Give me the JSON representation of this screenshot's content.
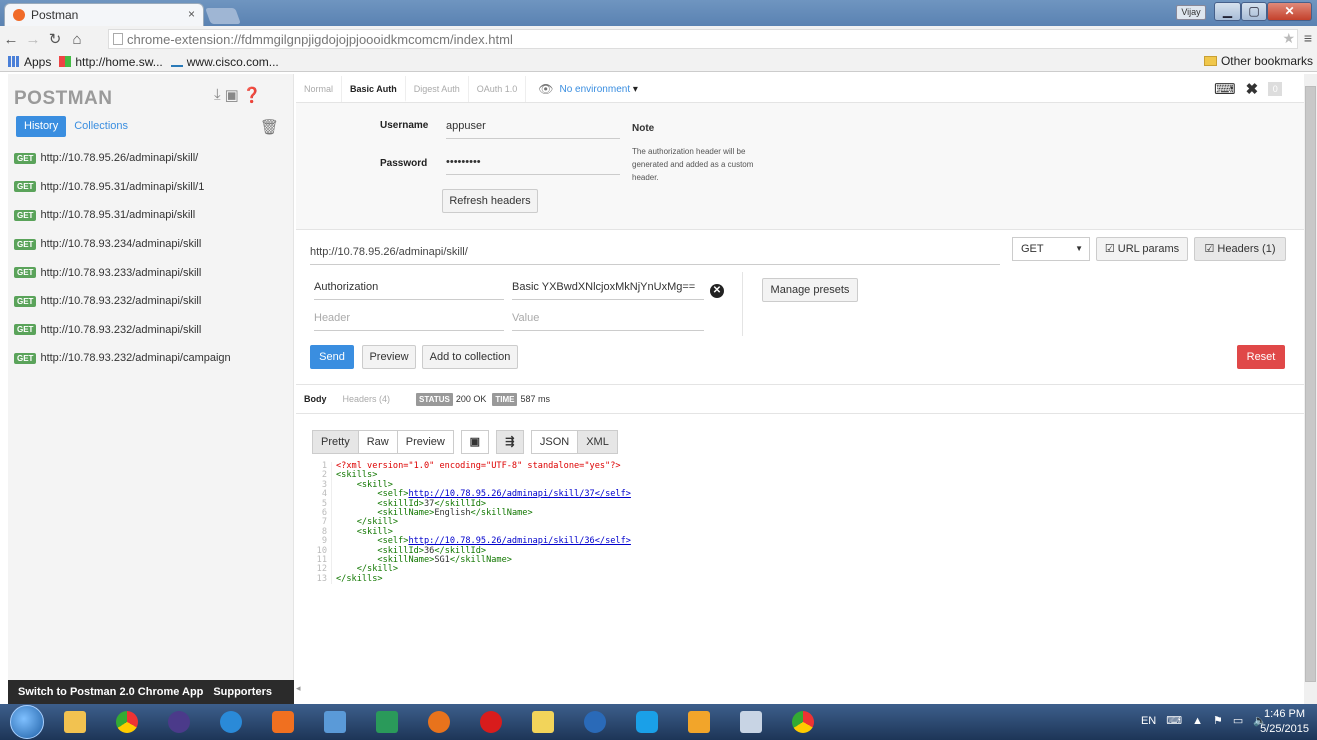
{
  "browser": {
    "tab_title": "Postman",
    "tab_close": "×",
    "url": "chrome-extension://fdmmgilgnpjigdojojpjoooidkmcomcm/index.html",
    "user_badge": "Vijay",
    "bookmarks": [
      "Apps",
      "http://home.sw...",
      "www.cisco.com..."
    ],
    "other_bookmarks": "Other bookmarks"
  },
  "sidebar": {
    "logo": "POSTMAN",
    "tabs": [
      "History",
      "Collections"
    ],
    "history": [
      {
        "method": "GET",
        "url": "http://10.78.95.26/adminapi/skill/"
      },
      {
        "method": "GET",
        "url": "http://10.78.95.31/adminapi/skill/1"
      },
      {
        "method": "GET",
        "url": "http://10.78.95.31/adminapi/skill"
      },
      {
        "method": "GET",
        "url": "http://10.78.93.234/adminapi/skill"
      },
      {
        "method": "GET",
        "url": "http://10.78.93.233/adminapi/skill"
      },
      {
        "method": "GET",
        "url": "http://10.78.93.232/adminapi/skill"
      },
      {
        "method": "GET",
        "url": "http://10.78.93.232/adminapi/skill"
      },
      {
        "method": "GET",
        "url": "http://10.78.93.232/adminapi/campaign"
      }
    ],
    "footer_left": "Switch to Postman 2.0 Chrome App",
    "footer_right": "Supporters"
  },
  "auth": {
    "tabs": [
      "Normal",
      "Basic Auth",
      "Digest Auth",
      "OAuth 1.0"
    ],
    "environment": "No environment",
    "counter": "0",
    "username_label": "Username",
    "username_value": "appuser",
    "password_label": "Password",
    "password_value": "•••••••••",
    "note_title": "Note",
    "note_text": "The authorization header will be generated and added as a custom header.",
    "refresh_button": "Refresh headers"
  },
  "request": {
    "url": "http://10.78.95.26/adminapi/skill/",
    "method": "GET",
    "url_params_button": "URL params",
    "headers_button": "Headers (1)",
    "header_key": "Authorization",
    "header_value": "Basic YXBwdXNlcjoxMkNjYnUxMg==",
    "header_placeholder": "Header",
    "value_placeholder": "Value",
    "manage_presets": "Manage presets",
    "send": "Send",
    "preview": "Preview",
    "add_to_collection": "Add to collection",
    "reset": "Reset"
  },
  "response": {
    "tabs": [
      "Body",
      "Headers (4)"
    ],
    "status_label": "STATUS",
    "status_value": "200 OK",
    "time_label": "TIME",
    "time_value": "587 ms",
    "view_buttons": [
      "Pretty",
      "Raw",
      "Preview"
    ],
    "format_buttons": [
      "JSON",
      "XML"
    ],
    "code_lines": [
      "<?xml version=\"1.0\" encoding=\"UTF-8\" standalone=\"yes\"?>",
      "<skills>",
      "    <skill>",
      "        <self>http://10.78.95.26/adminapi/skill/37</self>",
      "        <skillId>37</skillId>",
      "        <skillName>English</skillName>",
      "    </skill>",
      "    <skill>",
      "        <self>http://10.78.95.26/adminapi/skill/36</self>",
      "        <skillId>36</skillId>",
      "        <skillName>SG1</skillName>",
      "    </skill>",
      "</skills>"
    ]
  },
  "taskbar": {
    "language": "EN",
    "time": "1:46 PM",
    "date": "5/25/2015"
  },
  "colors": {
    "accent": "#3a8ee0",
    "danger": "#e04848",
    "get_badge": "#5aa35a"
  }
}
